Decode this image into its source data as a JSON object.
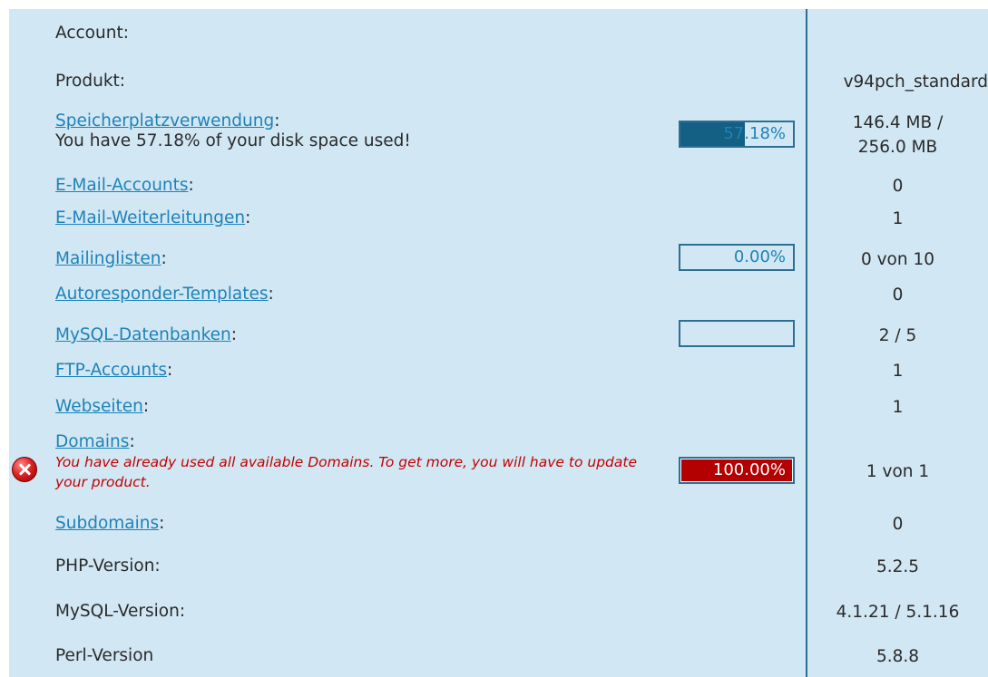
{
  "colors": {
    "panel_bg": "#d1e7f3",
    "link": "#1f82b8",
    "divider": "#2c6f93",
    "bar_fill": "#145f84",
    "bar_full": "#b30000",
    "error_text": "#c40000"
  },
  "rows": {
    "account": {
      "label": "Account:",
      "value": ""
    },
    "product": {
      "label": "Produkt:",
      "value": "v94pch_standard"
    },
    "disk": {
      "link": "Speicherplatzverwendung",
      "suffix": ":",
      "message": "You have 57.18% of your disk space used!",
      "bar_text": "57.18%",
      "bar_fraction": 0.5718,
      "value_line1": "146.4 MB /",
      "value_line2": "256.0 MB"
    },
    "email_accounts": {
      "link": "E-Mail-Accounts",
      "suffix": ":",
      "value": "0"
    },
    "email_forwards": {
      "link": "E-Mail-Weiterleitungen",
      "suffix": ":",
      "value": "1"
    },
    "mailinglists": {
      "link": "Mailinglisten",
      "suffix": ":",
      "bar_text": "0.00%",
      "bar_fraction": 0.0,
      "value": "0 von 10"
    },
    "autoresponder": {
      "link": "Autoresponder-Templates",
      "suffix": ":",
      "value": "0"
    },
    "mysql_db": {
      "link": "MySQL-Datenbanken",
      "suffix": ":",
      "bar_text": "",
      "value": "2 / 5"
    },
    "ftp": {
      "link": "FTP-Accounts",
      "suffix": ":",
      "value": "1"
    },
    "websites": {
      "link": "Webseiten",
      "suffix": ":",
      "value": "1"
    },
    "domains": {
      "link": "Domains",
      "suffix": ":",
      "error": "You have already used all available Domains. To get more, you will have to update your product.",
      "error_icon": "error-icon",
      "bar_text": "100.00%",
      "bar_fraction": 1.0,
      "value": "1 von 1"
    },
    "subdomains": {
      "link": "Subdomains",
      "suffix": ":",
      "value": "0"
    },
    "php": {
      "label": "PHP-Version:",
      "value": "5.2.5"
    },
    "mysql_version": {
      "label": "MySQL-Version:",
      "value": "4.1.21 / 5.1.16"
    },
    "perl": {
      "label": "Perl-Version",
      "value": "5.8.8"
    }
  }
}
